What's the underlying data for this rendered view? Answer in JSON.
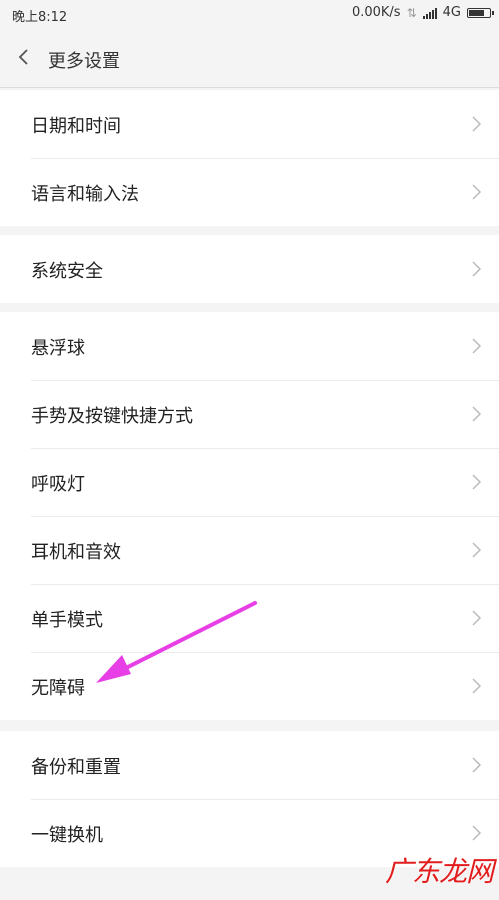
{
  "status_bar": {
    "time": "晚上8:12",
    "network_speed": "0.00K/s",
    "network_type": "4G",
    "battery_level": 0.8
  },
  "header": {
    "title": "更多设置"
  },
  "groups": [
    {
      "items": [
        {
          "label": "日期和时间"
        },
        {
          "label": "语言和输入法"
        }
      ]
    },
    {
      "items": [
        {
          "label": "系统安全"
        }
      ]
    },
    {
      "items": [
        {
          "label": "悬浮球"
        },
        {
          "label": "手势及按键快捷方式"
        },
        {
          "label": "呼吸灯"
        },
        {
          "label": "耳机和音效"
        },
        {
          "label": "单手模式"
        },
        {
          "label": "无障碍"
        }
      ]
    },
    {
      "items": [
        {
          "label": "备份和重置"
        },
        {
          "label": "一键换机"
        }
      ]
    }
  ],
  "annotation": {
    "arrow_color": "#e83ee6",
    "points_to": "无障碍"
  },
  "watermark": {
    "text": "广东龙网",
    "color": "#e21d1d"
  }
}
